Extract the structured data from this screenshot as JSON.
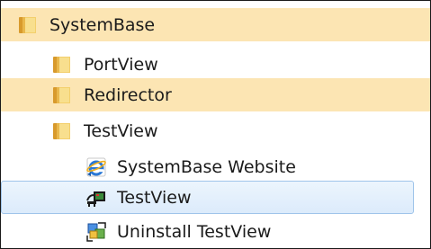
{
  "tree": {
    "items": [
      {
        "label": "SystemBase",
        "icon": "folder-icon"
      },
      {
        "label": "PortView",
        "icon": "folder-icon"
      },
      {
        "label": "Redirector",
        "icon": "folder-icon"
      },
      {
        "label": "TestView",
        "icon": "folder-icon"
      },
      {
        "label": "SystemBase Website",
        "icon": "internet-explorer-icon"
      },
      {
        "label": "TestView",
        "icon": "testview-app-icon"
      },
      {
        "label": "Uninstall TestView",
        "icon": "uninstall-icon"
      }
    ]
  },
  "colors": {
    "highlight_gold": "#fce5b3",
    "selection_blue": "#dcebfb",
    "selection_border": "#9fc4ea"
  }
}
